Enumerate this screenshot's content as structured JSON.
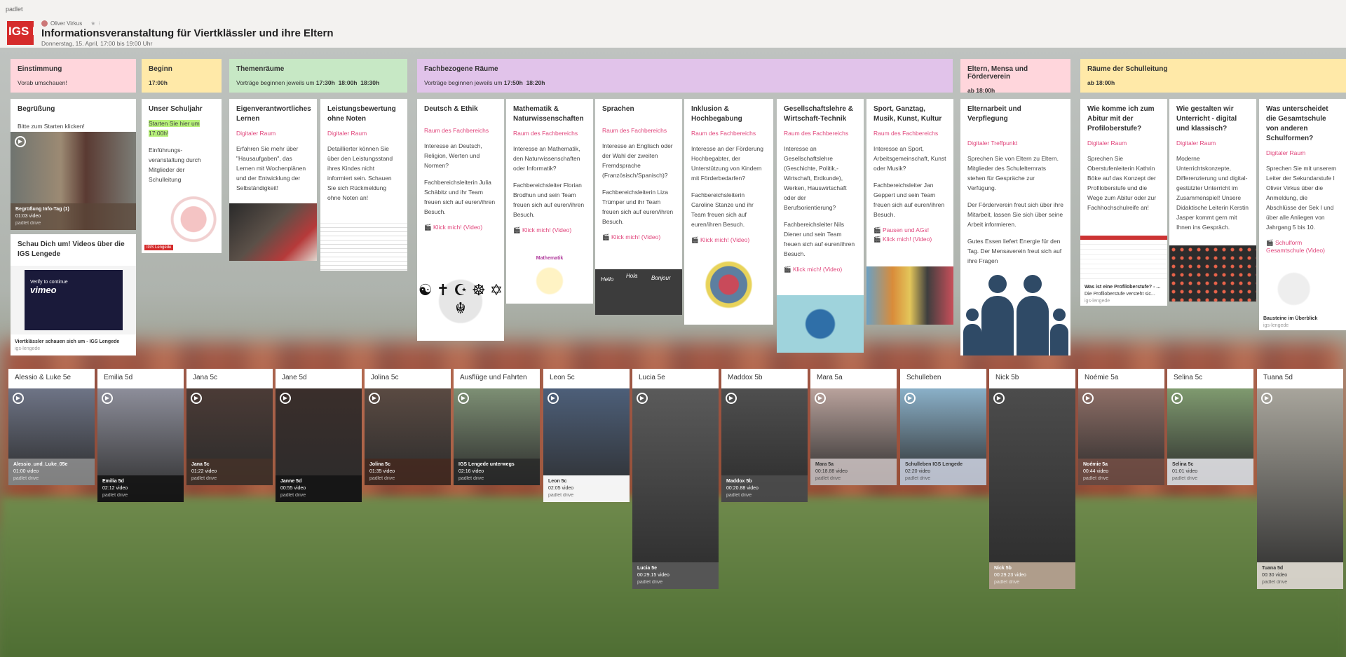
{
  "brand": "padlet",
  "board": {
    "logo_text": "IGS L",
    "author": "Oliver Virkus",
    "star": "★",
    "ellipsis": "⁝",
    "title": "Informationsveranstaltung für Viertklässler und ihre Eltern",
    "subtitle": "Donnerstag, 15. April, 17:00 bis 19:00 Uhr"
  },
  "colors": {
    "pink": "#ffd6dc",
    "yellow": "#ffe9a8",
    "green": "#c7e8c5",
    "lilac": "#e1c3ea",
    "accent": "#e0457b",
    "highlight": "#b8f27a"
  },
  "sections": {
    "einstimmung": {
      "title": "Einstimmung",
      "sub": "Vorab umschauen!"
    },
    "beginn": {
      "title": "Beginn",
      "sub": "17:00h"
    },
    "themen": {
      "title": "Themenräume",
      "sub": "Vorträge beginnen jeweils um",
      "t1": "17:30h",
      "t2": "18:00h",
      "t3": "18:30h"
    },
    "fach": {
      "title": "Fachbezogene Räume",
      "sub": "Vorträge beginnen jeweils um",
      "t1": "17:50h",
      "t2": "18:20h"
    },
    "eltern": {
      "title": "Eltern, Mensa und Förderverein",
      "sub": "ab 18:00h"
    },
    "schule": {
      "title": "Räume der Schulleitung",
      "sub": "ab 18:00h"
    }
  },
  "cards": {
    "begruessung": {
      "title": "Begrüßung",
      "text": "Bitte zum Starten klicken!",
      "cap_title": "Begrüßung Info-Tag (1)",
      "cap_meta": "01:03 video",
      "cap_src": "padlet drive"
    },
    "schau": {
      "title": "Schau Dich um! Videos über die IGS Lengede",
      "cap_title": "Viertklässler schauen sich um - IGS Lengede",
      "cap_src": "igs-lengede",
      "vimeo": "vimeo",
      "verify": "Verify to continue"
    },
    "schuljahr": {
      "title": "Unser Schuljahr",
      "hl": "Starten Sie hier um 17:00h!",
      "text": "Einführungs-veranstaltung durch Mitglieder der Schulleitung",
      "img_label": "IGS Lengede"
    },
    "eigen": {
      "title": "Eigenverantwortliches Lernen",
      "link": "Digitaler Raum",
      "text": "Erfahren Sie mehr über \"Hausaufgaben\", das Lernen mit Wochenplänen und der Entwicklung der Selbständigkeit!"
    },
    "leistung": {
      "title": "Leistungsbewertung ohne Noten",
      "link": "Digitaler Raum",
      "text": "Detaillierter können Sie über den Leistungsstand ihres Kindes nicht informiert sein. Schauen Sie sich Rückmeldung ohne Noten an!"
    },
    "deutsch": {
      "title": "Deutsch & Ethik",
      "link": "Raum des Fachbereichs",
      "t1": "Interesse an Deutsch, Religion, Werten und Normen?",
      "t2": "Fachbereichsleiterin Julia Schäbitz und ihr Team freuen sich auf euren/ihren Besuch.",
      "video": "🎬 Klick mich! (Video)"
    },
    "mathe": {
      "title": "Mathematik & Naturwissenschaften",
      "link": "Raum des Fachbereichs",
      "t1": "Interesse an Mathematik, den Naturwissenschaften oder Informatik?",
      "t2": "Fachbereichsleiter Florian Brodhun und sein Team freuen sich auf euren/ihren Besuch.",
      "video": "🎬 Klick mich! (Video)",
      "img_label": "Mathematik"
    },
    "sprachen": {
      "title": "Sprachen",
      "link": "Raum des Fachbereichs",
      "t1": "Interesse an Englisch oder der Wahl der zweiten Fremdsprache (Französisch/Spanisch)?",
      "t2": "Fachbereichsleiterin Liza Trümper und ihr Team freuen sich auf euren/ihren Besuch.",
      "video": "🎬 Klick mich! (Video)",
      "img1": "Hello",
      "img2": "Bonjour",
      "img3": "Hola"
    },
    "inklusion": {
      "title": "Inklusion & Hochbegabung",
      "link": "Raum des Fachbereichs",
      "t1": "Interesse an der Förderung Hochbegabter, der Unterstützung von Kindern mit Förderbedarfen?",
      "t2": "Fachbereichsleiterin Caroline Stanze und ihr Team freuen sich auf euren/ihren Besuch.",
      "video": "🎬 Klick mich! (Video)"
    },
    "gesell": {
      "title": "Gesellschaftslehre & Wirtschaft-Technik",
      "link": "Raum des Fachbereichs",
      "t1": "Interesse an Gesellschaftslehre (Geschichte, Politik,-Wirtschaft, Erdkunde), Werken, Hauswirtschaft oder der Berufsorientierung?",
      "t2": "Fachbereichsleiter Nils Diener und sein Team freuen sich auf euren/ihren Besuch.",
      "video": "🎬 Klick mich! (Video)"
    },
    "sport": {
      "title": "Sport, Ganztag, Musik, Kunst, Kultur",
      "link": "Raum des Fachbereichs",
      "t1": "Interesse an Sport, Arbeitsgemeinschaft, Kunst oder Musik?",
      "t2": "Fachbereichsleiter Jan Geppert und sein Team freuen sich auf euren/ihren Besuch.",
      "v1": "🎬 Pausen und AGs!",
      "v2": "🎬 Klick mich! (Video)"
    },
    "elternarbeit": {
      "title": "Elternarbeit und Verpflegung",
      "link": "Digitaler Treffpunkt",
      "t1": "Sprechen Sie von Eltern zu Eltern. Mitglieder des Schulelternrats stehen für Gespräche zur Verfügung.",
      "t2": "Der Förderverein freut sich über ihre Mitarbeit, lassen Sie sich über seine Arbeit informieren.",
      "t3": "Gutes Essen liefert Energie für den Tag. Der Mensaverein freut sich auf ihre Fragen"
    },
    "abitur": {
      "title": "Wie komme ich zum Abitur mit der Profiloberstufe?",
      "link": "Digitaler Raum",
      "text": "Sprechen Sie Oberstufenleiterin Kathrin Böke auf das Konzept der Profiloberstufe und die Wege zum Abitur oder zur Fachhochschulreife an!",
      "cap_title": "Was ist eine Profiloberstufe? - ...",
      "cap_meta": "Die Profiloberstufe versteht sic...",
      "cap_src": "igs-lengede"
    },
    "unterricht": {
      "title": "Wie gestalten wir Unterricht - digital und klassisch?",
      "link": "Digitaler Raum",
      "text": "Moderne Unterrichtskonzepte, Differenzierung und digital-gestützter Unterricht im Zusammenspiel! Unsere Didaktische Leiterin Kerstin Jasper kommt gern mit Ihnen ins Gespräch."
    },
    "gesamtschule": {
      "title": "Was unterscheidet die Gesamtschule von anderen Schulformen?",
      "link": "Digitaler Raum",
      "text": "Sprechen Sie mit unserem Leiter der Sekundarstufe I Oliver Virkus über die Anmeldung, die Abschlüsse der Sek I und über alle Anliegen von Jahrgang 5 bis 10.",
      "video": "🎬 Schulform Gesamtschule (Video)",
      "cap_title": "Bausteine im Überblick",
      "cap_src": "igs-lengede"
    }
  },
  "videos": [
    {
      "title": "Alessio & Luke 5e",
      "cap": "Alessio_und_Luke_05e",
      "meta": "01:00 video",
      "src": "padlet drive"
    },
    {
      "title": "Emilia 5d",
      "cap": "Emilia 5d",
      "meta": "02:12 video",
      "src": "padlet drive"
    },
    {
      "title": "Jana 5c",
      "cap": "Jana 5c",
      "meta": "01:22 video",
      "src": "padlet drive"
    },
    {
      "title": "Jane 5d",
      "cap": "Janne 5d",
      "meta": "00:55 video",
      "src": "padlet drive"
    },
    {
      "title": "Jolina 5c",
      "cap": "Jolina 5c",
      "meta": "01:35 video",
      "src": "padlet drive"
    },
    {
      "title": "Ausflüge und Fahrten",
      "cap": "IGS Lengede unterwegs",
      "meta": "02:16 video",
      "src": "padlet drive"
    },
    {
      "title": "Leon 5c",
      "cap": "Leon 5c",
      "meta": "02:05 video",
      "src": "padlet drive"
    },
    {
      "title": "Lucia 5e",
      "cap": "Lucia 5e",
      "meta": "00:29.15 video",
      "src": "padlet drive"
    },
    {
      "title": "Maddox 5b",
      "cap": "Maddox 5b",
      "meta": "00:20.88 video",
      "src": "padlet drive"
    },
    {
      "title": "Mara 5a",
      "cap": "Mara 5a",
      "meta": "00:18.88 video",
      "src": "padlet drive"
    },
    {
      "title": "Schulleben",
      "cap": "Schulleben IGS Lengede",
      "meta": "02:20 video",
      "src": "padlet drive"
    },
    {
      "title": "Nick 5b",
      "cap": "Nick 5b",
      "meta": "00:29.23 video",
      "src": "padlet drive"
    },
    {
      "title": "Noémie 5a",
      "cap": "Noémie 5a",
      "meta": "00:44 video",
      "src": "padlet drive"
    },
    {
      "title": "Selina 5c",
      "cap": "Selina 5c",
      "meta": "01:01 video",
      "src": "padlet drive"
    },
    {
      "title": "Tuana 5d",
      "cap": "Tuana 5d",
      "meta": "00:30 video",
      "src": "padlet drive"
    }
  ],
  "icons": {
    "play": "▶",
    "religion": "☯ ✝ ☪ ☸ ✡ ☬",
    "heart": "♥"
  }
}
